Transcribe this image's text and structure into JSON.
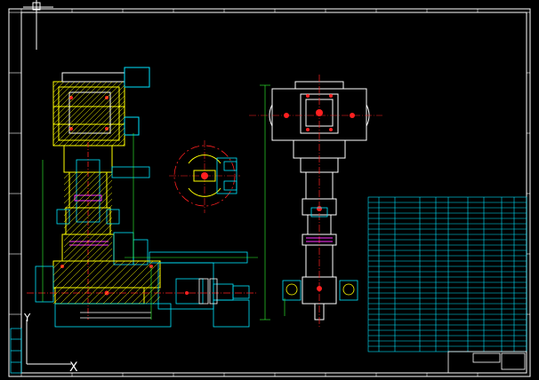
{
  "viewport": {
    "ucs_y_label": "Y",
    "ucs_x_label": "X"
  },
  "colors": {
    "background": "#000000",
    "frame": "#ffffff",
    "cyan": "#00e5ff",
    "yellow": "#ffff00",
    "red": "#ff2020",
    "magenta": "#ff33ff",
    "green": "#33ff33",
    "blue": "#3355ff",
    "white": "#ffffff"
  },
  "icons": {
    "crosshair": "crosshair-cursor-icon",
    "ucs": "ucs-axis-icon"
  }
}
